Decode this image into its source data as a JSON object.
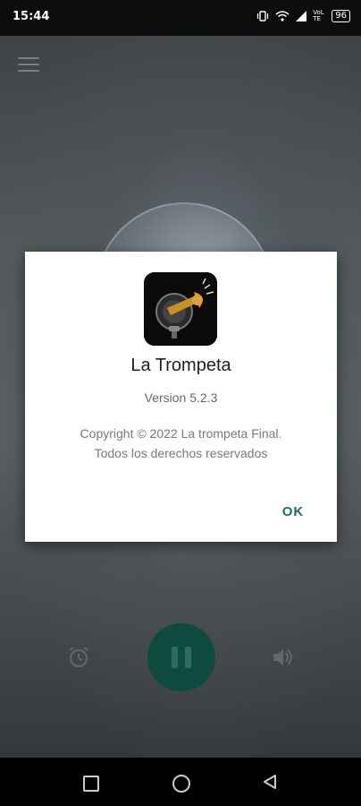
{
  "status_bar": {
    "time": "15:44",
    "network": "VoLTE",
    "battery": "96"
  },
  "player": {
    "icons": [
      "menu-icon",
      "alarm-icon",
      "pause-icon",
      "volume-icon"
    ]
  },
  "dialog": {
    "app_name": "La Trompeta",
    "version": "Version 5.2.3",
    "copyright_line1": "Copyright © 2022 La trompeta Final.",
    "copyright_line2": "Todos los derechos reservados",
    "ok_label": "OK"
  },
  "nav_bar": {
    "icons": [
      "recents-icon",
      "home-icon",
      "back-icon"
    ]
  },
  "colors": {
    "accent": "#1b6f5c",
    "play_button": "#0f4a3e"
  }
}
